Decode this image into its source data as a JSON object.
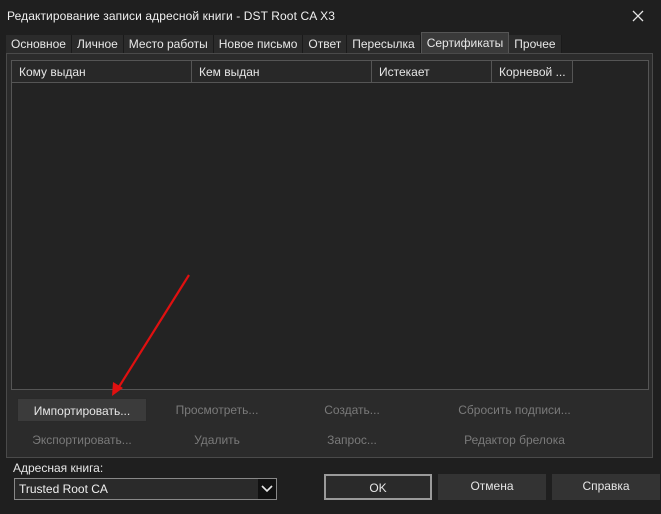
{
  "window": {
    "title": "Редактирование записи адресной книги - DST Root CA X3"
  },
  "tabs": [
    {
      "label": "Основное"
    },
    {
      "label": "Личное"
    },
    {
      "label": "Место работы"
    },
    {
      "label": "Новое письмо"
    },
    {
      "label": "Ответ"
    },
    {
      "label": "Пересылка"
    },
    {
      "label": "Сертификаты",
      "active": true
    },
    {
      "label": "Прочее"
    }
  ],
  "list": {
    "columns": [
      "Кому выдан",
      "Кем выдан",
      "Истекает",
      "Корневой ..."
    ]
  },
  "actions": {
    "import": "Импортировать...",
    "view": "Просмотреть...",
    "create": "Создать...",
    "reset_signatures": "Сбросить подписи...",
    "export": "Экспортировать...",
    "delete": "Удалить",
    "request": "Запрос...",
    "keyring_editor": "Редактор брелока"
  },
  "address_book": {
    "label": "Адресная книга:",
    "value": "Trusted Root CA"
  },
  "dialog_buttons": {
    "ok": "OK",
    "cancel": "Отмена",
    "help": "Справка"
  },
  "annotation": {
    "arrow_color": "#e01010"
  }
}
